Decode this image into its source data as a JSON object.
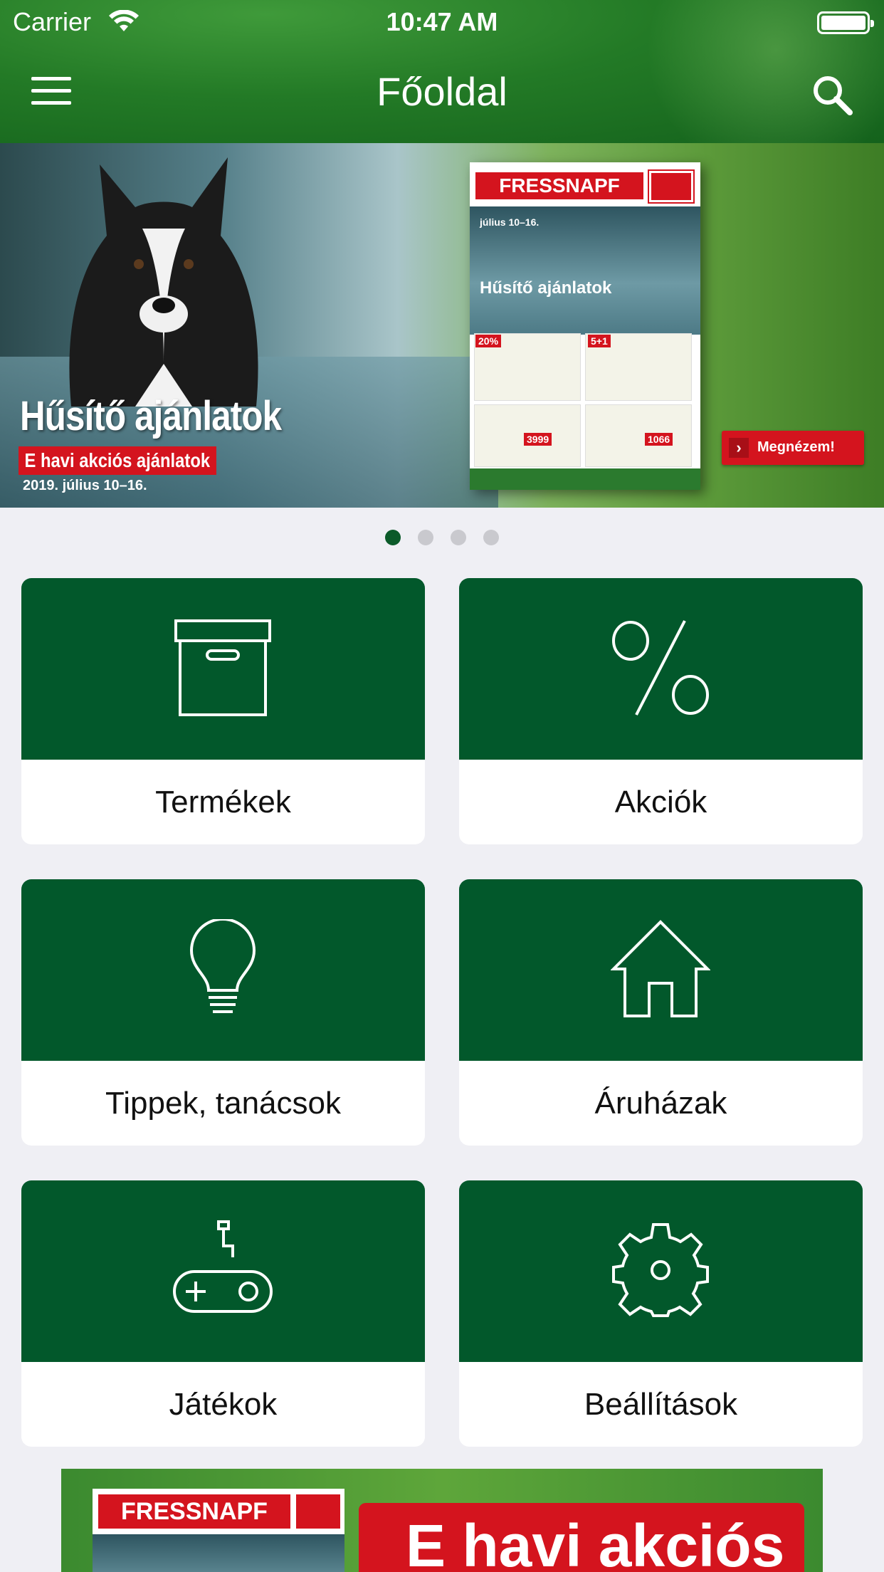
{
  "status_bar": {
    "carrier": "Carrier",
    "time": "10:47 AM"
  },
  "nav": {
    "title": "Főoldal",
    "menu_icon": "hamburger-menu-icon",
    "search_icon": "search-icon"
  },
  "banner": {
    "headline": "Hűsítő ajánlatok",
    "subheadline": "E havi akciós ajánlatok",
    "date": "2019. július 10–16.",
    "magazine_brand": "FRESSNAPF",
    "magazine_title": "Hűsítő ajánlatok",
    "magazine_date": "július 10–16.",
    "cta_label": "Megnézem!",
    "cta_icon": "chevron-right-icon"
  },
  "pager": {
    "count": 4,
    "active_index": 0
  },
  "tiles": [
    {
      "label": "Termékek",
      "icon": "box-icon"
    },
    {
      "label": "Akciók",
      "icon": "percent-icon"
    },
    {
      "label": "Tippek, tanácsok",
      "icon": "lightbulb-icon"
    },
    {
      "label": "Áruházak",
      "icon": "house-icon"
    },
    {
      "label": "Játékok",
      "icon": "gamepad-icon"
    },
    {
      "label": "Beállítások",
      "icon": "gear-icon"
    }
  ],
  "bottom_ad": {
    "brand": "FRESSNAPF",
    "text": "E havi akciós"
  },
  "colors": {
    "header_green": "#237a26",
    "tile_green": "#02582b",
    "accent_red": "#d4141e",
    "background": "#efeff4",
    "pager_active": "#0b5a29",
    "pager_inactive": "#c9c9ce"
  }
}
